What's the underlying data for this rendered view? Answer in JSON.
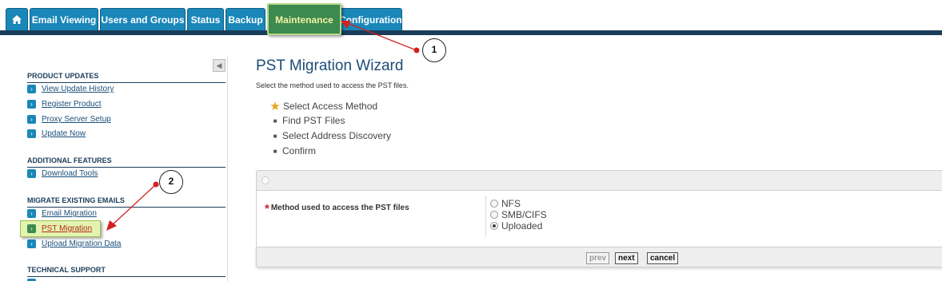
{
  "tabs": [
    {
      "label": "",
      "icon": "home-icon"
    },
    {
      "label": "Email Viewing"
    },
    {
      "label": "Users and Groups"
    },
    {
      "label": "Status"
    },
    {
      "label": "Backup"
    },
    {
      "label": "Maintenance",
      "active": true
    },
    {
      "label": "Configuration"
    }
  ],
  "sidebar": {
    "collapse_icon": "collapse-left-icon",
    "sections": [
      {
        "title": "PRODUCT UPDATES",
        "items": [
          "View Update History",
          "Register Product",
          "Proxy Server Setup",
          "Update Now"
        ]
      },
      {
        "title": "ADDITIONAL FEATURES",
        "items": [
          "Download Tools"
        ]
      },
      {
        "title": "MIGRATE EXISTING EMAILS",
        "items": [
          "Email Migration",
          "PST Migration",
          "Upload Migration Data"
        ]
      },
      {
        "title": "TECHNICAL SUPPORT",
        "items": []
      }
    ]
  },
  "wizard": {
    "title": "PST Migration Wizard",
    "subtitle": "Select the method used to access the PST files.",
    "steps": [
      {
        "label": "Select Access Method",
        "current": true,
        "icon": "star-icon"
      },
      {
        "label": "Find PST Files"
      },
      {
        "label": "Select Address Discovery"
      },
      {
        "label": "Confirm"
      }
    ],
    "method_label": "Method used to access the PST files",
    "required_marker": "*",
    "options": [
      {
        "label": "NFS",
        "selected": false
      },
      {
        "label": "SMB/CIFS",
        "selected": false
      },
      {
        "label": "Uploaded",
        "selected": true
      }
    ],
    "buttons": {
      "prev": "prev",
      "next": "next",
      "cancel": "cancel"
    }
  },
  "annotations": [
    {
      "number": "1"
    },
    {
      "number": "2"
    }
  ],
  "colors": {
    "tab_blue": "#1a87b9",
    "tab_active": "#3c8a4d",
    "nav_line": "#1c3d5a",
    "annotation_red": "#d42020"
  }
}
